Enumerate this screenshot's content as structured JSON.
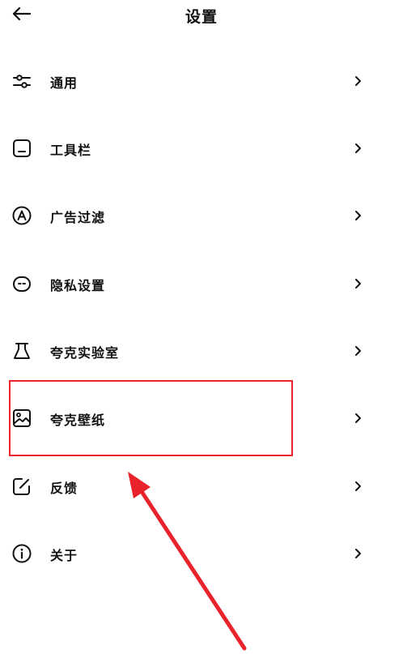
{
  "header": {
    "title": "设置",
    "back_icon": "arrow-left-icon"
  },
  "menu": {
    "items": [
      {
        "label": "通用",
        "icon": "sliders-icon"
      },
      {
        "label": "工具栏",
        "icon": "toolbar-icon"
      },
      {
        "label": "广告过滤",
        "icon": "ad-filter-icon"
      },
      {
        "label": "隐私设置",
        "icon": "privacy-mask-icon"
      },
      {
        "label": "夸克实验室",
        "icon": "flask-icon"
      },
      {
        "label": "夸克壁纸",
        "icon": "wallpaper-icon"
      },
      {
        "label": "反馈",
        "icon": "feedback-edit-icon"
      },
      {
        "label": "关于",
        "icon": "info-icon"
      }
    ],
    "chevron_icon": "chevron-right-icon"
  },
  "annotation": {
    "highlighted_item": "夸克壁纸",
    "highlight_color": "#e8232b",
    "arrow_color": "#e8232b"
  }
}
